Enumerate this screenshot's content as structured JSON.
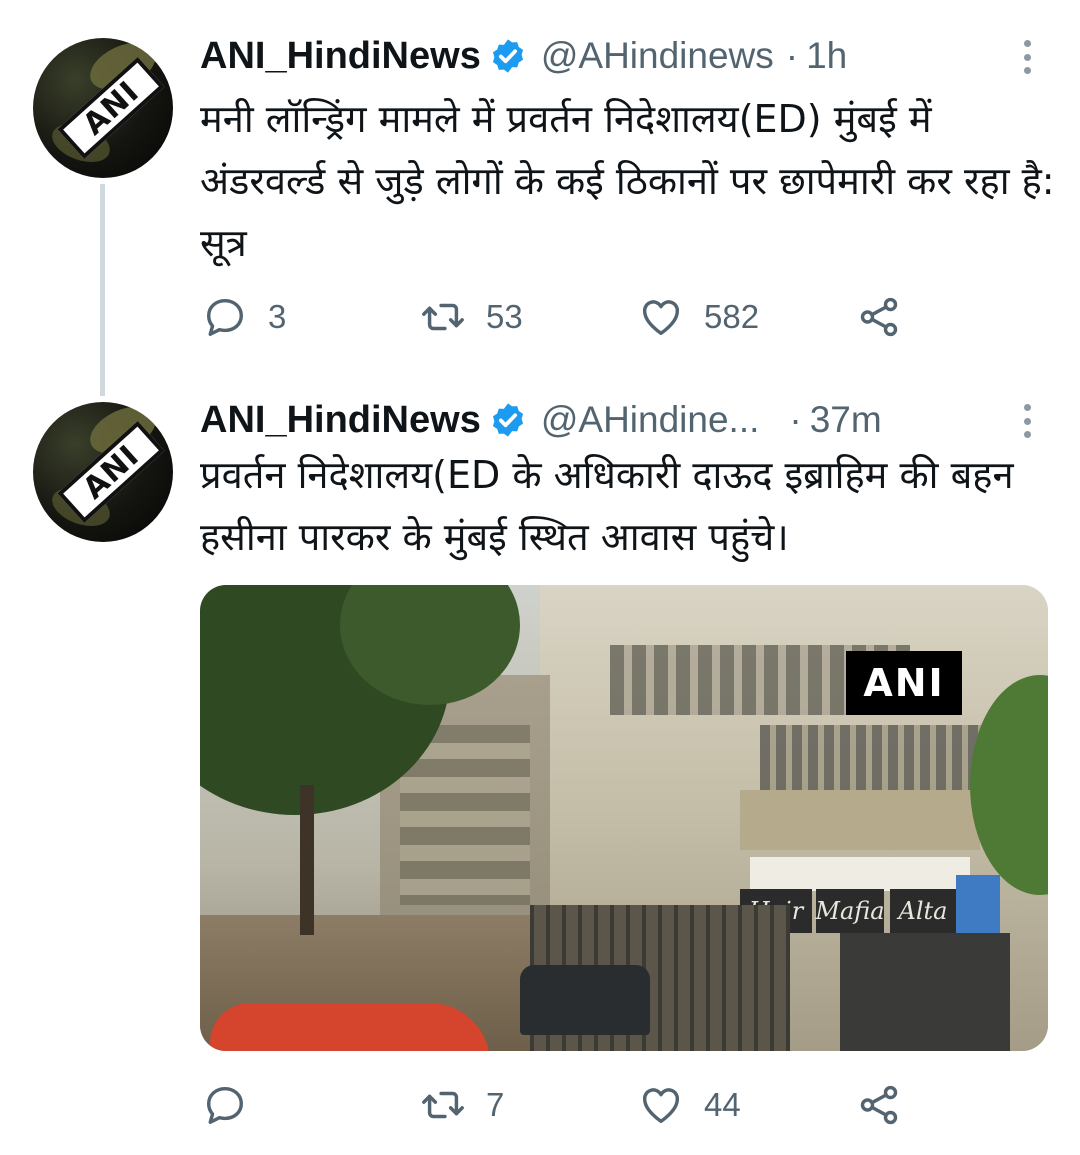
{
  "tweets": [
    {
      "name": "ANI_HindiNews",
      "handle": "@AHindinews",
      "dot": "·",
      "time": "1h",
      "avatar_label": "ANI",
      "text": "मनी लॉन्ड्रिंग मामले में प्रवर्तन निदेशालय(ED) मुंबई में अंडरवर्ल्ड से जुड़े लोगों के कई ठिकानों पर छापेमारी कर रहा है: सूत्र",
      "reply_count": "3",
      "retweet_count": "53",
      "like_count": "582"
    },
    {
      "name": "ANI_HindiNews",
      "handle": "@AHindine...",
      "dot": "·",
      "time": "37m",
      "avatar_label": "ANI",
      "text": "प्रवर्तन निदेशालय(ED के अधिकारी दाऊद इब्राहिम की बहन हसीना पारकर के मुंबई स्थित आवास पहुंचे।",
      "media": {
        "watermark": "ANI",
        "shop_signs": [
          "Hair",
          "Mafia",
          "Alta"
        ]
      },
      "reply_count": "",
      "retweet_count": "7",
      "like_count": "44"
    }
  ],
  "icons": {
    "verified": "verified-badge-icon",
    "reply": "reply-icon",
    "retweet": "retweet-icon",
    "like": "heart-icon",
    "share": "share-icon",
    "more": "more-vertical-icon"
  },
  "colors": {
    "verified": "#1d9bf0",
    "secondary_text": "#536471",
    "primary_text": "#0f1419",
    "thread_line": "#cfd9de"
  }
}
